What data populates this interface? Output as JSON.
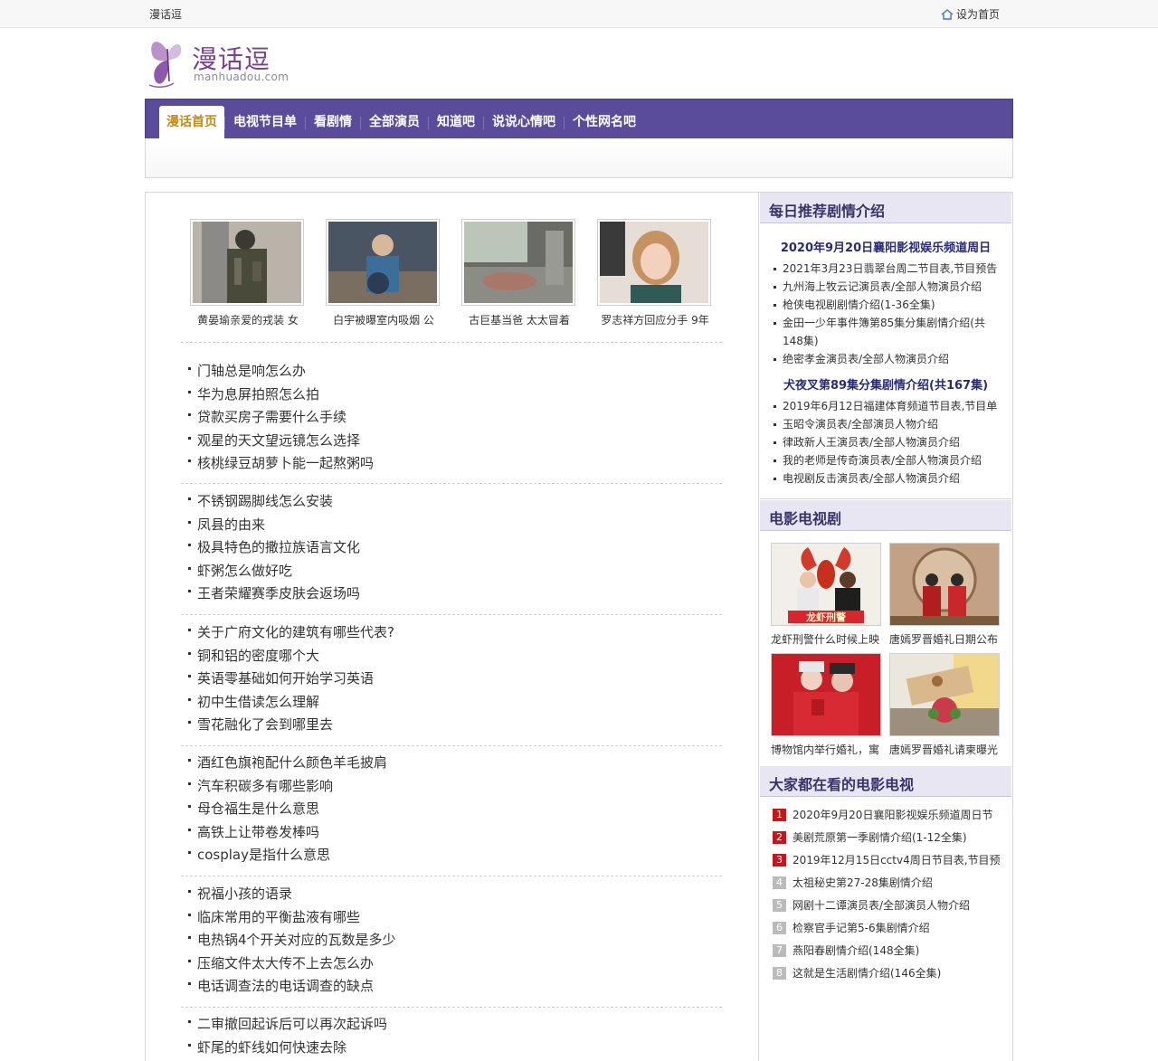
{
  "topbar": {
    "site_name": "漫话逗",
    "set_home": "设为首页"
  },
  "logo": {
    "title": "漫话逗",
    "domain": "manhuadou.com"
  },
  "nav": {
    "items": [
      {
        "label": "漫话首页",
        "active": true
      },
      {
        "label": "电视节目单"
      },
      {
        "label": "看剧情"
      },
      {
        "label": "全部演员"
      },
      {
        "label": "知道吧"
      },
      {
        "label": "说说心情吧"
      },
      {
        "label": "个性网名吧"
      }
    ]
  },
  "thumbs": [
    {
      "caption": "黄晏瑜亲爱的戎装 女"
    },
    {
      "caption": "白宇被曝室内吸烟 公"
    },
    {
      "caption": "古巨基当爸 太太冒着"
    },
    {
      "caption": "罗志祥方回应分手 9年"
    }
  ],
  "article_groups": [
    [
      "门轴总是响怎么办",
      "华为息屏拍照怎么拍",
      "贷款买房子需要什么手续",
      "观星的天文望远镜怎么选择",
      "核桃绿豆胡萝卜能一起熬粥吗"
    ],
    [
      "不锈钢踢脚线怎么安装",
      "凤县的由来",
      "极具特色的撒拉族语言文化",
      "虾粥怎么做好吃",
      "王者荣耀赛季皮肤会返场吗"
    ],
    [
      "关于广府文化的建筑有哪些代表?",
      "铜和铝的密度哪个大",
      "英语零基础如何开始学习英语",
      "初中生借读怎么理解",
      "雪花融化了会到哪里去"
    ],
    [
      "酒红色旗袍配什么颜色羊毛披肩",
      "汽车积碳多有哪些影响",
      "母仓福生是什么意思",
      "高铁上让带卷发棒吗",
      "cosplay是指什么意思"
    ],
    [
      "祝福小孩的语录",
      "临床常用的平衡盐液有哪些",
      "电热锅4个开关对应的瓦数是多少",
      "压缩文件太大传不上去怎么办",
      "电话调查法的电话调查的缺点"
    ],
    [
      "二审撤回起诉后可以再次起诉吗",
      "虾尾的虾线如何快速去除"
    ]
  ],
  "sidebar": {
    "daily": {
      "title": "每日推荐剧情介绍",
      "feature1": "2020年9月20日襄阳影视娱乐频道周日",
      "list1": [
        "2021年3月23日翡翠台周二节目表,节目预告",
        "九州海上牧云记演员表/全部人物演员介绍",
        "枪侠电视剧剧情介绍(1-36全集)",
        "金田一少年事件簿第85集分集剧情介绍(共148集)",
        "绝密孝金演员表/全部人物演员介绍"
      ],
      "feature2": "犬夜叉第89集分集剧情介绍(共167集)",
      "list2": [
        "2019年6月12日福建体育频道节目表,节目单",
        "玉昭令演员表/全部演员人物介绍",
        "律政新人王演员表/全部人物演员介绍",
        "我的老师是传奇演员表/全部人物演员介绍",
        "电视剧反击演员表/全部人物演员介绍"
      ]
    },
    "movies": {
      "title": "电影电视剧",
      "items": [
        {
          "caption": "龙虾刑警什么时候上映",
          "art": "龙虾刑警"
        },
        {
          "caption": "唐嫣罗晋婚礼日期公布"
        },
        {
          "caption": "博物馆内举行婚礼，寓"
        },
        {
          "caption": "唐嫣罗晋婚礼请柬曝光"
        }
      ]
    },
    "popular": {
      "title": "大家都在看的电影电视",
      "items": [
        {
          "num": "1",
          "label": "2020年9月20日襄阳影视娱乐频道周日节"
        },
        {
          "num": "2",
          "label": "美剧荒原第一季剧情介绍(1-12全集)"
        },
        {
          "num": "3",
          "label": "2019年12月15日cctv4周日节目表,节目预"
        },
        {
          "num": "4",
          "label": "太祖秘史第27-28集剧情介绍"
        },
        {
          "num": "5",
          "label": "网剧十二谭演员表/全部演员人物介绍"
        },
        {
          "num": "6",
          "label": "检察官手记第5-6集剧情介绍"
        },
        {
          "num": "7",
          "label": "燕阳春剧情介绍(148全集)"
        },
        {
          "num": "8",
          "label": "这就是生活剧情介绍(146全集)"
        }
      ]
    }
  },
  "colors": {
    "nav_bg": "#5a4c9a",
    "nav_active_text": "#c58a10",
    "logo": "#7a3e94",
    "rank_hot": "#c4161c"
  }
}
